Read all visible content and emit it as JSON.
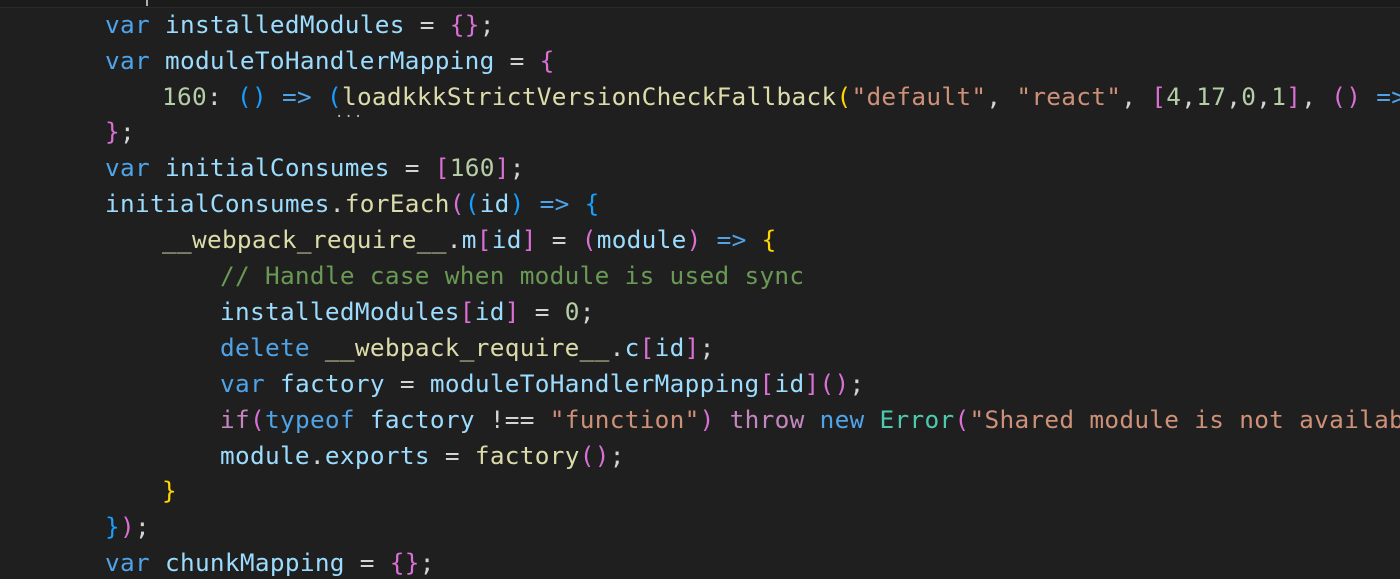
{
  "editor": {
    "background": "#1f1f1f",
    "theme_colors": {
      "keyword": "#4fa3e8",
      "control": "#c586c0",
      "variable": "#9cdcfe",
      "function": "#dcdcaa",
      "string": "#ce9178",
      "number": "#b5cea8",
      "class": "#4ec9b0",
      "comment": "#6a9955",
      "bracket_1": "#ffd700",
      "bracket_2": "#da70d6",
      "bracket_3": "#179fff"
    },
    "lines": [
      [
        "var",
        "installedModules",
        "=",
        "{",
        "}",
        ";"
      ],
      [
        "var",
        "moduleToHandlerMapping",
        "=",
        "{"
      ],
      [
        "160",
        ":",
        "(",
        ")",
        "=>",
        "(",
        "loadkkkStrictVersionCheckFallback",
        "(",
        "\"default\"",
        ",",
        "\"react\"",
        ",",
        "[",
        "4",
        ",",
        "17",
        ",",
        "0",
        ",",
        "1",
        "]",
        ",",
        "(",
        ")",
        "=>",
        "(_"
      ],
      [
        "}",
        ";"
      ],
      [
        "var",
        "initialConsumes",
        "=",
        "[",
        "160",
        "]",
        ";"
      ],
      [
        "initialConsumes",
        ".",
        "forEach",
        "(",
        "(",
        "id",
        ")",
        "=>",
        "{"
      ],
      [
        "__webpack_require__",
        ".",
        "m",
        "[",
        "id",
        "]",
        "=",
        "(",
        "module",
        ")",
        "=>",
        "{"
      ],
      [
        "// Handle case when module is used sync"
      ],
      [
        "installedModules",
        "[",
        "id",
        "]",
        "=",
        "0",
        ";"
      ],
      [
        "delete",
        "__webpack_require__",
        ".",
        "c",
        "[",
        "id",
        "]",
        ";"
      ],
      [
        "var",
        "factory",
        "=",
        "moduleToHandlerMapping",
        "[",
        "id",
        "]",
        "(",
        ")",
        ";"
      ],
      [
        "if",
        "(",
        "typeof",
        "factory",
        "!==",
        "\"function\"",
        ")",
        "throw",
        "new",
        "Error",
        "(",
        "\"Shared module is not available"
      ],
      [
        "module",
        ".",
        "exports",
        "=",
        "factory",
        "(",
        ")",
        ";"
      ],
      [
        "}"
      ],
      [
        "}",
        ")",
        ";"
      ],
      [
        "var",
        "chunkMapping",
        "=",
        "{",
        "}",
        ";"
      ]
    ],
    "hover_hint": "..."
  }
}
